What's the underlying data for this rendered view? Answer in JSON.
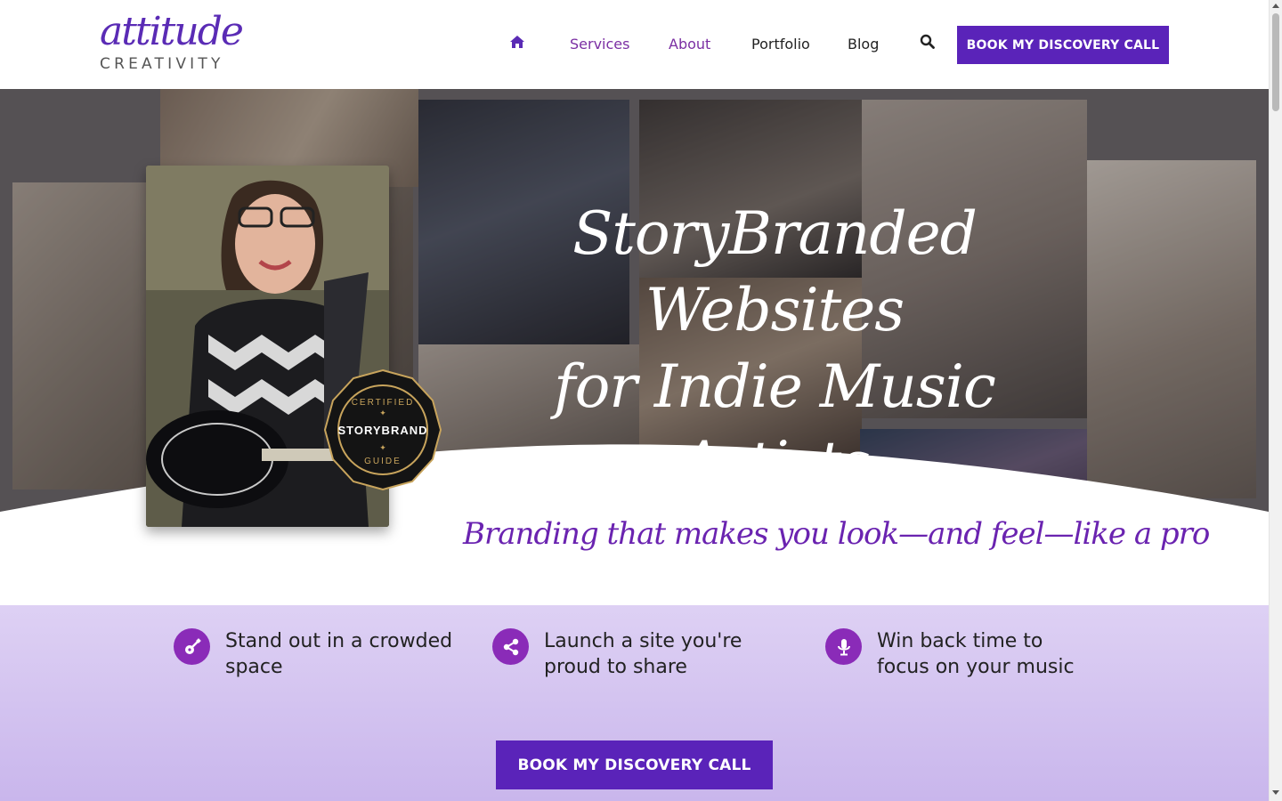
{
  "header": {
    "logo": {
      "script": "attitude",
      "sub": "CREATIVITY"
    },
    "nav": {
      "home_icon": "home-icon",
      "services": "Services",
      "about": "About",
      "portfolio": "Portfolio",
      "blog": "Blog",
      "search_icon": "search-icon"
    },
    "cta": "BOOK MY DISCOVERY CALL"
  },
  "hero": {
    "title_line1": "StoryBranded Websites",
    "title_line2": "for Indie Music Artists",
    "badge": {
      "top": "CERTIFIED",
      "middle": "STORYBRAND",
      "bottom": "GUIDE"
    },
    "tagline": "Branding that makes you look—and feel—like a pro"
  },
  "benefits": [
    {
      "icon": "guitar-icon",
      "text": "Stand out in a crowded space"
    },
    {
      "icon": "share-icon",
      "text": "Launch a site you're proud to share"
    },
    {
      "icon": "microphone-icon",
      "text": "Win back time to focus on your music"
    }
  ],
  "cta_main": "BOOK MY DISCOVERY CALL",
  "colors": {
    "brand_purple": "#5a23b9",
    "accent_purple": "#8a2bb8",
    "nav_purple": "#7b2fa3"
  }
}
